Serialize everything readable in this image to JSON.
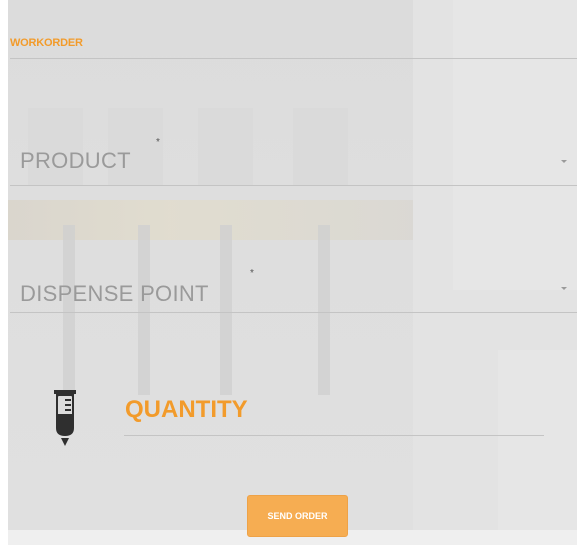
{
  "workorder": {
    "title": "WORKORDER"
  },
  "product": {
    "label": "PRODUCT",
    "required_marker": "*"
  },
  "dispense_point": {
    "label": "DISPENSE POINT",
    "required_marker": "*"
  },
  "quantity": {
    "label": "QUANTITY",
    "icon": "beaker-icon"
  },
  "actions": {
    "send_label": "SEND ORDER"
  },
  "colors": {
    "accent": "#f29b2b",
    "button": "#f6ad52",
    "label": "#9a9a9a"
  }
}
